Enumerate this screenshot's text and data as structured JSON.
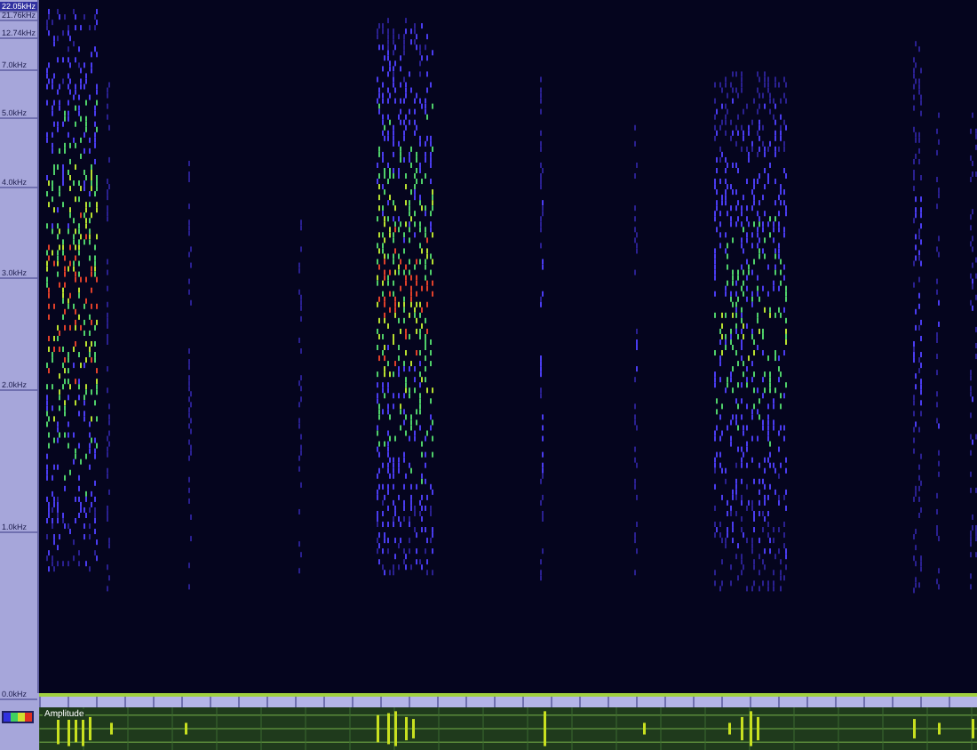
{
  "frequency_axis": {
    "labels": [
      {
        "text": "22.05kHz",
        "selected": true
      },
      {
        "text": "21.76kHz",
        "selected": false
      },
      {
        "text": "12.74kHz",
        "selected": false
      },
      {
        "text": "7.0kHz",
        "selected": false
      },
      {
        "text": "5.0kHz",
        "selected": false
      },
      {
        "text": "4.0kHz",
        "selected": false
      },
      {
        "text": "3.0kHz",
        "selected": false
      },
      {
        "text": "2.0kHz",
        "selected": false
      },
      {
        "text": "1.0kHz",
        "selected": false
      },
      {
        "text": "0.0kHz",
        "selected": false
      }
    ]
  },
  "waveform": {
    "label": "Amplitude"
  }
}
